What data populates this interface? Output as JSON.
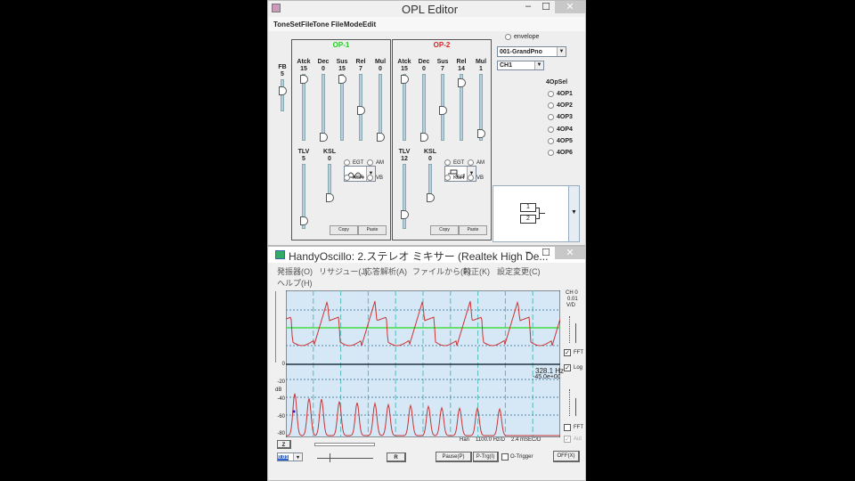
{
  "opl": {
    "title": "OPL Editor",
    "menu": [
      "ToneSetFile",
      "Tone File",
      "Mode",
      "Edit"
    ],
    "fb": {
      "label": "FB",
      "value": 5,
      "max": 7
    },
    "ops": [
      {
        "name": "OP-1",
        "color": "#22cc22",
        "sliders": [
          {
            "label": "Atck",
            "value": 15,
            "max": 15
          },
          {
            "label": "Dec",
            "value": 0,
            "max": 15
          },
          {
            "label": "Sus",
            "value": 15,
            "max": 15
          },
          {
            "label": "Rel",
            "value": 7,
            "max": 15
          },
          {
            "label": "Mul",
            "value": 0,
            "max": 15
          }
        ],
        "tlv": {
          "label": "TLV",
          "value": 5,
          "max": 63
        },
        "ksl": {
          "label": "KSL",
          "value": 0,
          "max": 3
        },
        "wave": "sine-wave-icon"
      },
      {
        "name": "OP-2",
        "color": "#dd2222",
        "sliders": [
          {
            "label": "Atck",
            "value": 15,
            "max": 15
          },
          {
            "label": "Dec",
            "value": 0,
            "max": 15
          },
          {
            "label": "Sus",
            "value": 7,
            "max": 15
          },
          {
            "label": "Rel",
            "value": 14,
            "max": 15
          },
          {
            "label": "Mul",
            "value": 1,
            "max": 15
          }
        ],
        "tlv": {
          "label": "TLV",
          "value": 12,
          "max": 63
        },
        "ksl": {
          "label": "KSL",
          "value": 0,
          "max": 3
        },
        "wave": "square-wave-icon"
      }
    ],
    "radios": [
      "EGT",
      "AM",
      "KSR",
      "VB"
    ],
    "copy": "Copy",
    "paste": "Paste",
    "envelope": "envelope",
    "tone": "001-GrandPno",
    "channel": "CH1",
    "opsel_label": "4OpSel",
    "opsel": [
      "4OP1",
      "4OP2",
      "4OP3",
      "4OP4",
      "4OP5",
      "4OP6"
    ],
    "algo": [
      "1",
      "2"
    ]
  },
  "osc": {
    "title": "HandyOscillo:  2.ステレオ ミキサー (Realtek High De...",
    "menu": [
      "発振器(O)",
      "リサジュー(J)",
      "応答解析(A)",
      "ファイルから(F)",
      "較正(K)",
      "設定変更(C)"
    ],
    "menu2": "ヘルプ(H)",
    "ch": "CH 0",
    "vd": "0.01",
    "vdunit": "V/D",
    "fft1": "FFT",
    "log": "Log",
    "fft2": "FFT",
    "auto": "Aut",
    "freq": "328.1 Hz",
    "level": "-45.0e+00",
    "db": "dB",
    "db_ticks": [
      "0",
      "-20",
      "-40",
      "-60",
      "-80"
    ],
    "status": {
      "win": "Han",
      "hz": "1100.0 Hz/D",
      "ms": "2.4  mSEC/D"
    },
    "z": "Z",
    "r": "R",
    "sel": "0.01",
    "pause": "Pause(P)",
    "ptrg": "P-Trg(I)",
    "otrig": "O-Trigger",
    "off": "OFF(X)"
  }
}
